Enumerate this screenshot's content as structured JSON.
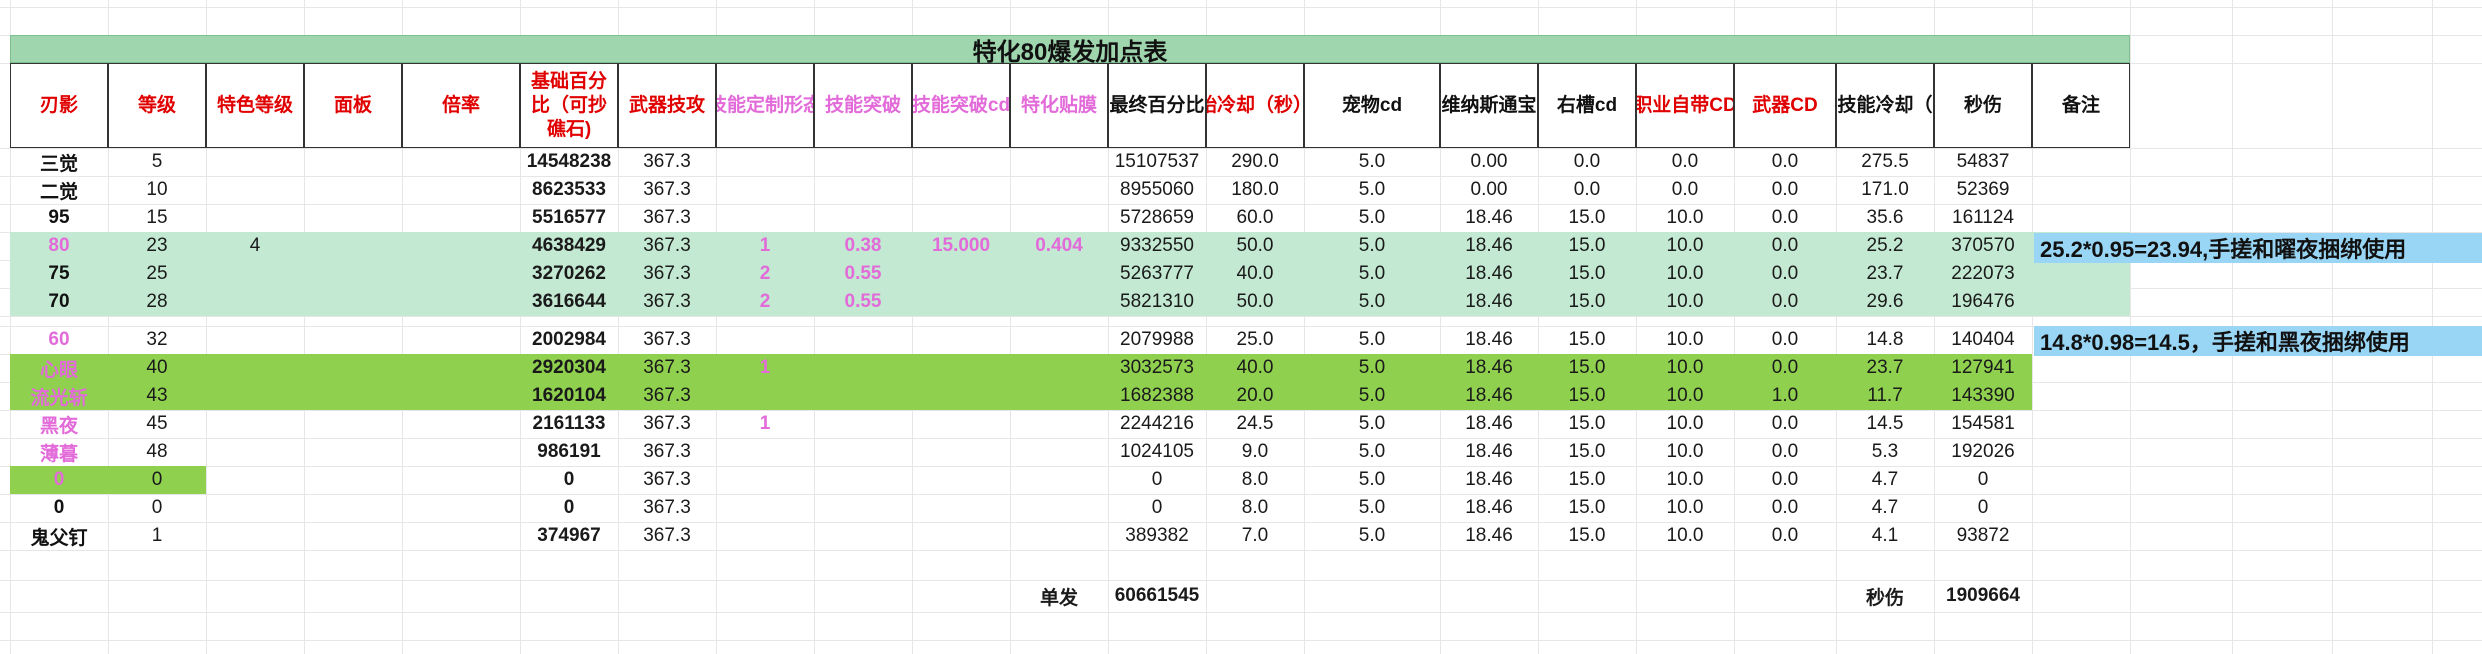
{
  "title": "特化80爆发加点表",
  "headers": [
    {
      "label": "刃影",
      "color": "red"
    },
    {
      "label": "等级",
      "color": "red"
    },
    {
      "label": "特色等级",
      "color": "red"
    },
    {
      "label": "面板",
      "color": "red"
    },
    {
      "label": "倍率",
      "color": "red"
    },
    {
      "label": "基础百分比（可抄礁石)",
      "color": "red"
    },
    {
      "label": "武器技攻",
      "color": "red"
    },
    {
      "label": "技能定制形态",
      "color": "pink"
    },
    {
      "label": "技能突破",
      "color": "pink"
    },
    {
      "label": "技能突破cd",
      "color": "pink"
    },
    {
      "label": "特化贴膜",
      "color": "pink"
    },
    {
      "label": "最终百分比",
      "color": "black"
    },
    {
      "label": "始冷却（秒）",
      "color": "red"
    },
    {
      "label": "宠物cd",
      "color": "black"
    },
    {
      "label": "维纳斯通宝",
      "color": "black"
    },
    {
      "label": "右槽cd",
      "color": "black"
    },
    {
      "label": "职业自带CD",
      "color": "red"
    },
    {
      "label": "武器CD",
      "color": "red"
    },
    {
      "label": "技能冷却（",
      "color": "black"
    },
    {
      "label": "秒伤",
      "color": "black"
    },
    {
      "label": "备注",
      "color": "black"
    }
  ],
  "rows": [
    {
      "cells": [
        "三觉",
        "5",
        "",
        "",
        "",
        "14548238",
        "367.3",
        "",
        "",
        "",
        "",
        "15107537",
        "290.0",
        "5.0",
        "0.00",
        "0.0",
        "0.0",
        "0.0",
        "275.5",
        "54837",
        ""
      ],
      "name_color": "black",
      "band": "none"
    },
    {
      "cells": [
        "二觉",
        "10",
        "",
        "",
        "",
        "8623533",
        "367.3",
        "",
        "",
        "",
        "",
        "8955060",
        "180.0",
        "5.0",
        "0.00",
        "0.0",
        "0.0",
        "0.0",
        "171.0",
        "52369",
        ""
      ],
      "name_color": "black",
      "band": "none"
    },
    {
      "cells": [
        "95",
        "15",
        "",
        "",
        "",
        "5516577",
        "367.3",
        "",
        "",
        "",
        "",
        "5728659",
        "60.0",
        "5.0",
        "18.46",
        "15.0",
        "10.0",
        "0.0",
        "35.6",
        "161124",
        ""
      ],
      "name_color": "black",
      "band": "none"
    },
    {
      "cells": [
        "80",
        "23",
        "4",
        "",
        "",
        "4638429",
        "367.3",
        "1",
        "0.38",
        "15.000",
        "0.404",
        "9332550",
        "50.0",
        "5.0",
        "18.46",
        "15.0",
        "10.0",
        "0.0",
        "25.2",
        "370570",
        ""
      ],
      "name_color": "pink",
      "band": "mint"
    },
    {
      "cells": [
        "75",
        "25",
        "",
        "",
        "",
        "3270262",
        "367.3",
        "2",
        "0.55",
        "",
        "",
        "5263777",
        "40.0",
        "5.0",
        "18.46",
        "15.0",
        "10.0",
        "0.0",
        "23.7",
        "222073",
        ""
      ],
      "name_color": "black",
      "band": "mint"
    },
    {
      "cells": [
        "70",
        "28",
        "",
        "",
        "",
        "3616644",
        "367.3",
        "2",
        "0.55",
        "",
        "",
        "5821310",
        "50.0",
        "5.0",
        "18.46",
        "15.0",
        "10.0",
        "0.0",
        "29.6",
        "196476",
        ""
      ],
      "name_color": "black",
      "band": "mint"
    },
    {
      "cells": [
        "60",
        "32",
        "",
        "",
        "",
        "2002984",
        "367.3",
        "",
        "",
        "",
        "",
        "2079988",
        "25.0",
        "5.0",
        "18.46",
        "15.0",
        "10.0",
        "0.0",
        "14.8",
        "140404",
        ""
      ],
      "name_color": "pink",
      "band": "none"
    },
    {
      "cells": [
        "心眼",
        "40",
        "",
        "",
        "",
        "2920304",
        "367.3",
        "1",
        "",
        "",
        "",
        "3032573",
        "40.0",
        "5.0",
        "18.46",
        "15.0",
        "10.0",
        "0.0",
        "23.7",
        "127941",
        ""
      ],
      "name_color": "pink",
      "band": "green"
    },
    {
      "cells": [
        "流光斩",
        "43",
        "",
        "",
        "",
        "1620104",
        "367.3",
        "",
        "",
        "",
        "",
        "1682388",
        "20.0",
        "5.0",
        "18.46",
        "15.0",
        "10.0",
        "1.0",
        "11.7",
        "143390",
        ""
      ],
      "name_color": "pink",
      "band": "green"
    },
    {
      "cells": [
        "黑夜",
        "45",
        "",
        "",
        "",
        "2161133",
        "367.3",
        "1",
        "",
        "",
        "",
        "2244216",
        "24.5",
        "5.0",
        "18.46",
        "15.0",
        "10.0",
        "0.0",
        "14.5",
        "154581",
        ""
      ],
      "name_color": "pink",
      "band": "none"
    },
    {
      "cells": [
        "薄暮",
        "48",
        "",
        "",
        "",
        "986191",
        "367.3",
        "",
        "",
        "",
        "",
        "1024105",
        "9.0",
        "5.0",
        "18.46",
        "15.0",
        "10.0",
        "0.0",
        "5.3",
        "192026",
        ""
      ],
      "name_color": "pink",
      "band": "none"
    },
    {
      "cells": [
        "0",
        "0",
        "",
        "",
        "",
        "0",
        "367.3",
        "",
        "",
        "",
        "",
        "0",
        "8.0",
        "5.0",
        "18.46",
        "15.0",
        "10.0",
        "0.0",
        "4.7",
        "0",
        ""
      ],
      "name_color": "pink",
      "band": "green-short"
    },
    {
      "cells": [
        "0",
        "0",
        "",
        "",
        "",
        "0",
        "367.3",
        "",
        "",
        "",
        "",
        "0",
        "8.0",
        "5.0",
        "18.46",
        "15.0",
        "10.0",
        "0.0",
        "4.7",
        "0",
        ""
      ],
      "name_color": "black",
      "band": "none"
    },
    {
      "cells": [
        "鬼父钉",
        "1",
        "",
        "",
        "",
        "374967",
        "367.3",
        "",
        "",
        "",
        "",
        "389382",
        "7.0",
        "5.0",
        "18.46",
        "15.0",
        "10.0",
        "0.0",
        "4.1",
        "93872",
        ""
      ],
      "name_color": "black",
      "band": "none"
    }
  ],
  "notes": [
    {
      "text": "25.2*0.95=23.94,手搓和曜夜捆绑使用",
      "row": 3
    },
    {
      "text": "14.8*0.98=14.5，手搓和黑夜捆绑使用",
      "row": 6
    }
  ],
  "footer": {
    "single_label": "单发",
    "single_value": "60661545",
    "dps_label": "秒伤",
    "dps_value": "1909664"
  },
  "colors": {
    "title_bg": "#9fd6ad",
    "mint_band": "#c3e9d2",
    "green_band": "#8fd14f",
    "note_bg": "#99d6f5",
    "header_red": "#e00000",
    "header_pink": "#e26bd9"
  }
}
